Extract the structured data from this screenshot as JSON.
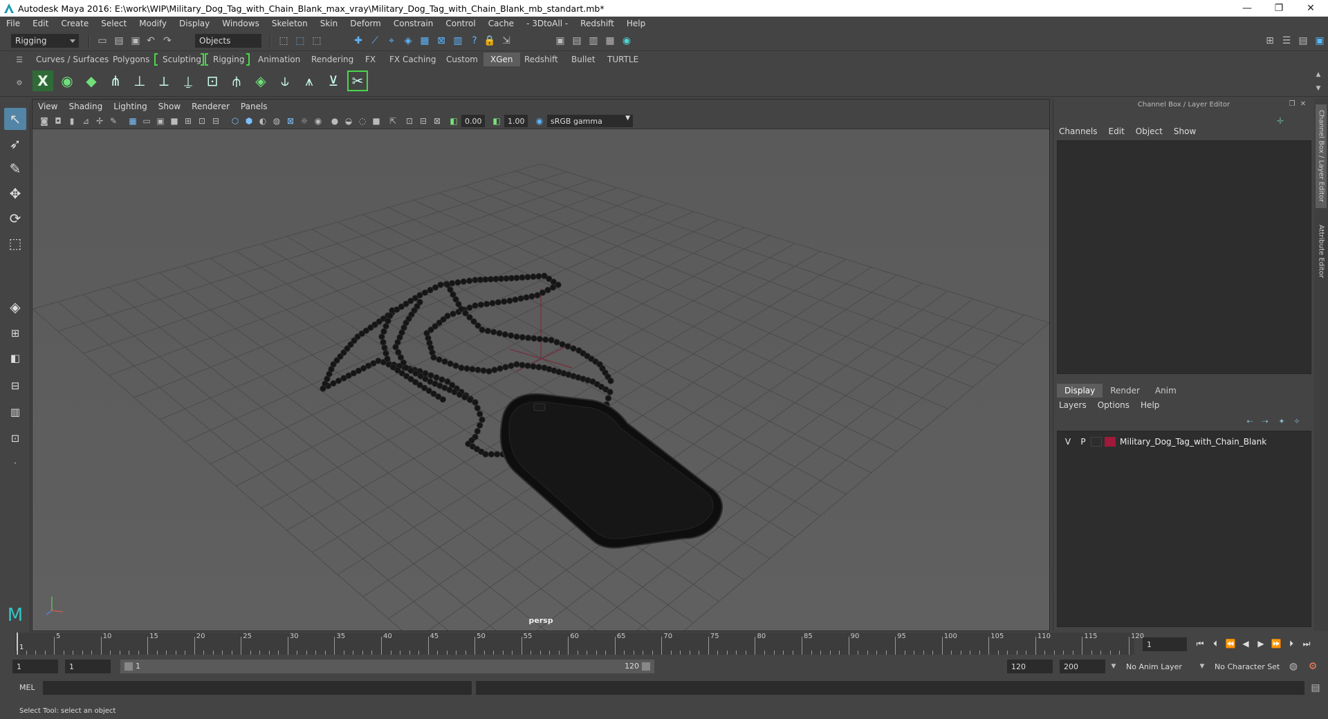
{
  "window": {
    "title": "Autodesk Maya 2016: E:\\work\\WIP\\Military_Dog_Tag_with_Chain_Blank_max_vray\\Military_Dog_Tag_with_Chain_Blank_mb_standart.mb*",
    "min": "—",
    "max": "❐",
    "close": "✕"
  },
  "menus": [
    "File",
    "Edit",
    "Create",
    "Select",
    "Modify",
    "Display",
    "Windows",
    "Skeleton",
    "Skin",
    "Deform",
    "Constrain",
    "Control",
    "Cache",
    "- 3DtoAll -",
    "Redshift",
    "Help"
  ],
  "statusline": {
    "menuset": "Rigging",
    "select_mode": "Objects"
  },
  "shelf_tabs": [
    "Curves / Surfaces",
    "Polygons",
    "Sculpting",
    "Rigging",
    "Animation",
    "Rendering",
    "FX",
    "FX Caching",
    "Custom",
    "XGen",
    "Redshift",
    "Bullet",
    "TURTLE"
  ],
  "active_shelf": "XGen",
  "viewport": {
    "menus": [
      "View",
      "Shading",
      "Lighting",
      "Show",
      "Renderer",
      "Panels"
    ],
    "exposure": "0.00",
    "gamma": "1.00",
    "colorspace": "sRGB gamma",
    "camera": "persp"
  },
  "channel_box": {
    "title": "Channel Box / Layer Editor",
    "menus": [
      "Channels",
      "Edit",
      "Object",
      "Show"
    ]
  },
  "layer_editor": {
    "tabs": [
      "Display",
      "Render",
      "Anim"
    ],
    "active_tab": "Display",
    "menus": [
      "Layers",
      "Options",
      "Help"
    ],
    "layers": [
      {
        "v": "V",
        "p": "P",
        "color": "#a0193a",
        "name": "Military_Dog_Tag_with_Chain_Blank"
      }
    ]
  },
  "side_tabs": [
    "Channel Box / Layer Editor",
    "Attribute Editor"
  ],
  "timeline": {
    "ticks": [
      "5",
      "10",
      "15",
      "20",
      "25",
      "30",
      "35",
      "40",
      "45",
      "50",
      "55",
      "60",
      "65",
      "70",
      "75",
      "80",
      "85",
      "90",
      "95",
      "100",
      "105",
      "110",
      "115",
      "120"
    ],
    "start_label": "1",
    "current_frame": "1"
  },
  "range": {
    "start": "1",
    "playback_start": "1",
    "slider_start": "1",
    "slider_end": "120",
    "playback_end": "120",
    "end": "200",
    "anim_layer": "No Anim Layer",
    "character_set": "No Character Set"
  },
  "command": {
    "lang": "MEL"
  },
  "help_line": "Select Tool: select an object"
}
